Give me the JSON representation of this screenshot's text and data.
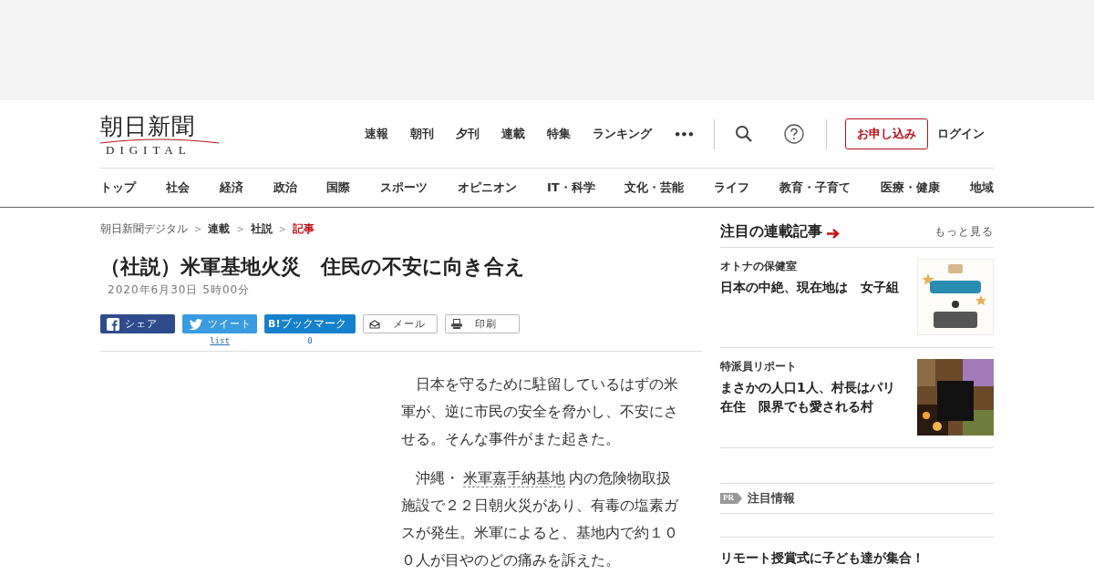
{
  "logo": {
    "title": "朝日新聞",
    "subtitle": "DIGITAL"
  },
  "top_nav": [
    "速報",
    "朝刊",
    "夕刊",
    "連載",
    "特集",
    "ランキング"
  ],
  "more_button": "•••",
  "signup_button": "お申し込み",
  "login_link": "ログイン",
  "category_nav": [
    "トップ",
    "社会",
    "経済",
    "政治",
    "国際",
    "スポーツ",
    "オピニオン",
    "IT・科学",
    "文化・芸能",
    "ライフ",
    "教育・子育て",
    "医療・健康",
    "地域"
  ],
  "breadcrumb": [
    {
      "label": "朝日新聞デジタル",
      "kind": "plain"
    },
    {
      "label": "連載",
      "kind": "bold"
    },
    {
      "label": "社説",
      "kind": "bold"
    },
    {
      "label": "記事",
      "kind": "current"
    }
  ],
  "breadcrumb_separator": ">",
  "article": {
    "title": "（社説）米軍基地火災　住民の不安に向き合え",
    "date": "2020年6月30日 5時00分",
    "share_buttons": [
      {
        "kind": "facebook",
        "label": "シェア"
      },
      {
        "kind": "twitter",
        "label": "ツイート",
        "count": "list"
      },
      {
        "kind": "hatena",
        "label": "ブックマーク",
        "mark": "B!",
        "count": "0"
      },
      {
        "kind": "mail",
        "label": "メール"
      },
      {
        "kind": "print",
        "label": "印刷"
      }
    ],
    "paragraphs": [
      {
        "text": "日本を守るために駐留しているはずの米軍が、逆に市民の安全を脅かし、不安にさせる。そんな事件がまた起きた。"
      },
      {
        "text": "沖縄・",
        "link": "米軍嘉手納基地",
        "after": "内の危険物取扱施設で２２日朝火災があり、有毒の塩素ガスが発生。米軍によると、基地内で約１００人が目やのどの痛みを訴えた。"
      }
    ]
  },
  "sidebar": {
    "heading": "注目の連載記事",
    "more_link": "もっと見る",
    "items": [
      {
        "series": "オトナの保健室",
        "title": "日本の中絶、現在地は　女子組"
      },
      {
        "series": "特派員リポート",
        "title": "まさかの人口1人、村長はパリ在住　限界でも愛される村"
      }
    ],
    "pr_badge": "PR",
    "pr_heading": "注目情報",
    "pr_title": "リモート授賞式に子ども達が集合！"
  }
}
